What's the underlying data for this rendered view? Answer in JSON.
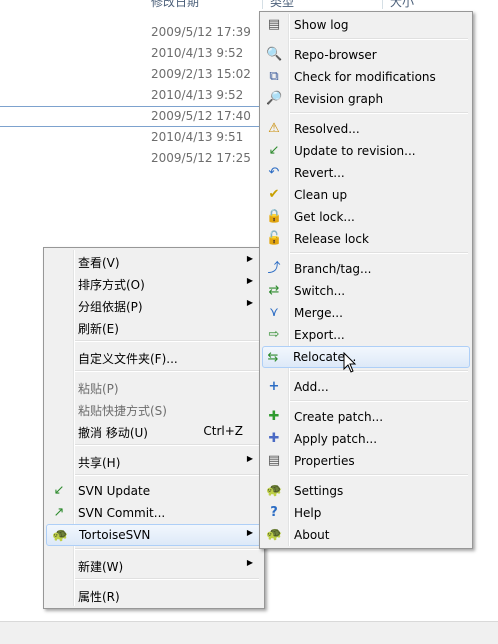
{
  "columns": {
    "date": "修改日期",
    "type": "类型",
    "size": "大小"
  },
  "dates": [
    "2009/5/12 17:39",
    "2010/4/13 9:52",
    "2009/2/13 15:02",
    "2010/4/13 9:52",
    "2009/5/12 17:40",
    "2010/4/13 9:51",
    "2009/5/12 17:25"
  ],
  "left_menu": {
    "items": [
      {
        "label": "查看(V)",
        "submenu": true
      },
      {
        "label": "排序方式(O)",
        "submenu": true
      },
      {
        "label": "分组依据(P)",
        "submenu": true
      },
      {
        "label": "刷新(E)"
      },
      {
        "label": "自定义文件夹(F)..."
      },
      {
        "label": "粘贴(P)",
        "disabled": true
      },
      {
        "label": "粘贴快捷方式(S)",
        "disabled": true
      },
      {
        "label": "撤消 移动(U)",
        "shortcut": "Ctrl+Z"
      },
      {
        "label": "共享(H)",
        "submenu": true
      },
      {
        "label": "SVN Update"
      },
      {
        "label": "SVN Commit..."
      },
      {
        "label": "TortoiseSVN",
        "submenu": true
      },
      {
        "label": "新建(W)",
        "submenu": true
      },
      {
        "label": "属性(R)"
      }
    ]
  },
  "svn_menu": {
    "items": [
      "Show log",
      "Repo-browser",
      "Check for modifications",
      "Revision graph",
      "Resolved...",
      "Update to revision...",
      "Revert...",
      "Clean up",
      "Get lock...",
      "Release lock",
      "Branch/tag...",
      "Switch...",
      "Merge...",
      "Export...",
      "Relocate...",
      "Add...",
      "Create patch...",
      "Apply patch...",
      "Properties",
      "Settings",
      "Help",
      "About"
    ]
  },
  "colors": {
    "menu_bg": "#f0f0f0",
    "highlight_border": "#aecff7",
    "selection_line": "#7da2ce"
  }
}
